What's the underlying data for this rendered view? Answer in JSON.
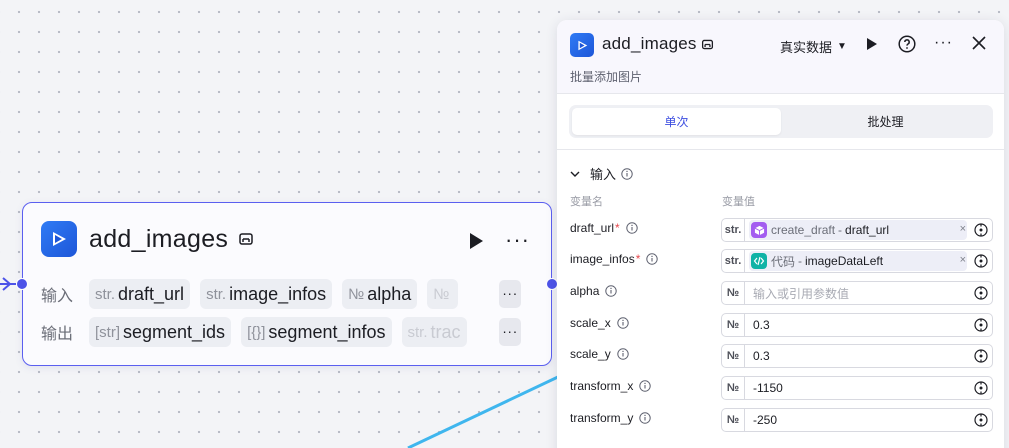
{
  "node": {
    "title": "add_images",
    "input_label": "输入",
    "output_label": "输出",
    "inputs": [
      {
        "type": "str.",
        "name": "draft_url"
      },
      {
        "type": "str.",
        "name": "image_infos"
      },
      {
        "type": "№",
        "name": "alpha"
      },
      {
        "type": "№",
        "name": ""
      }
    ],
    "outputs": [
      {
        "type": "[str]",
        "name": "segment_ids"
      },
      {
        "type": "[{}]",
        "name": "segment_infos"
      },
      {
        "type": "str.",
        "name": "trac"
      }
    ],
    "more_label": "···"
  },
  "panel": {
    "title": "add_images",
    "description": "批量添加图片",
    "mode": "真实数据",
    "more_label": "···",
    "tabs": [
      {
        "label": "单次",
        "active": true
      },
      {
        "label": "批处理",
        "active": false
      }
    ],
    "section_title": "输入",
    "col_name": "变量名",
    "col_value": "变量值",
    "rows": [
      {
        "name": "draft_url",
        "required": true,
        "type": "str.",
        "kind": "ref",
        "source": "create_draft",
        "field": "draft_url",
        "icon": "cube-icon",
        "icon_color": "#a35cf0"
      },
      {
        "name": "image_infos",
        "required": true,
        "type": "str.",
        "kind": "ref",
        "source": "代码",
        "field": "imageDataLeft",
        "icon": "code-icon",
        "icon_color": "#10b3a6"
      },
      {
        "name": "alpha",
        "required": false,
        "type": "№",
        "kind": "empty",
        "placeholder": "输入或引用参数值"
      },
      {
        "name": "scale_x",
        "required": false,
        "type": "№",
        "kind": "value",
        "value": "0.3"
      },
      {
        "name": "scale_y",
        "required": false,
        "type": "№",
        "kind": "value",
        "value": "0.3"
      },
      {
        "name": "transform_x",
        "required": false,
        "type": "№",
        "kind": "value",
        "value": "-1150"
      },
      {
        "name": "transform_y",
        "required": false,
        "type": "№",
        "kind": "value",
        "value": "-250"
      }
    ]
  },
  "colors": {
    "accent": "#4d53e8",
    "edge": "#3fb6ee",
    "node_border": "#5b5ff0"
  }
}
